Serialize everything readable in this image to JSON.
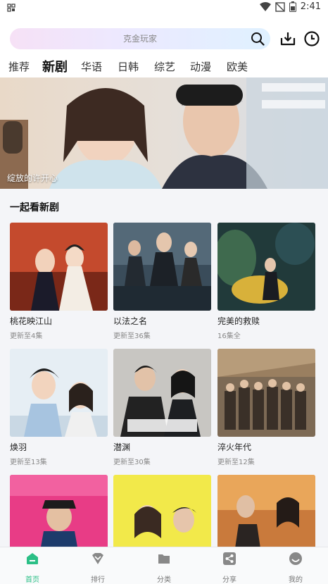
{
  "status_bar": {
    "time": "2:41"
  },
  "search": {
    "placeholder": "克金玩家"
  },
  "tabs": [
    {
      "label": "推荐",
      "active": false
    },
    {
      "label": "新剧",
      "active": true
    },
    {
      "label": "华语",
      "active": false
    },
    {
      "label": "日韩",
      "active": false
    },
    {
      "label": "综艺",
      "active": false
    },
    {
      "label": "动漫",
      "active": false
    },
    {
      "label": "欧美",
      "active": false
    }
  ],
  "banner": {
    "caption": "绽放的许开心"
  },
  "section": {
    "title": "一起看新剧"
  },
  "cards": [
    {
      "title": "桃花映江山",
      "sub": "更新至4集"
    },
    {
      "title": "以法之名",
      "sub": "更新至36集"
    },
    {
      "title": "完美的救赎",
      "sub": "16集全"
    },
    {
      "title": "焕羽",
      "sub": "更新至13集"
    },
    {
      "title": "潜渊",
      "sub": "更新至30集"
    },
    {
      "title": "淬火年代",
      "sub": "更新至12集"
    },
    {
      "title": "",
      "sub": ""
    },
    {
      "title": "",
      "sub": ""
    },
    {
      "title": "",
      "sub": ""
    }
  ],
  "bottom_nav": [
    {
      "label": "首页",
      "icon": "home-icon",
      "active": true
    },
    {
      "label": "排行",
      "icon": "rank-icon",
      "active": false
    },
    {
      "label": "分类",
      "icon": "folder-icon",
      "active": false
    },
    {
      "label": "分享",
      "icon": "share-icon",
      "active": false
    },
    {
      "label": "我的",
      "icon": "profile-icon",
      "active": false
    }
  ],
  "colors": {
    "accent": "#2bbf86",
    "tab_dot": "#f0b21b"
  }
}
